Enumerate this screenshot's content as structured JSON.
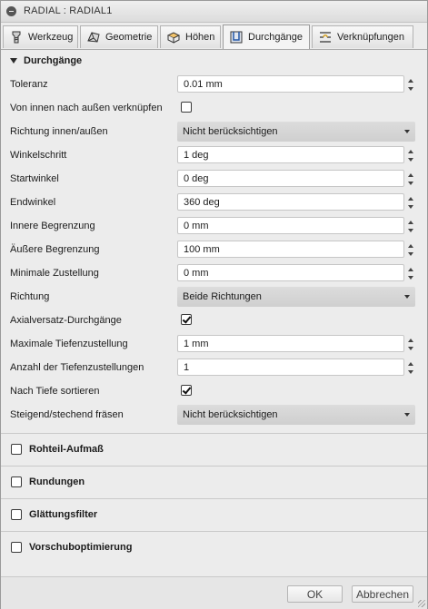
{
  "window": {
    "title": "RADIAL : RADIAL1"
  },
  "tabs": [
    {
      "label": "Werkzeug",
      "icon": "tool-icon"
    },
    {
      "label": "Geometrie",
      "icon": "geometry-icon"
    },
    {
      "label": "Höhen",
      "icon": "heights-icon"
    },
    {
      "label": "Durchgänge",
      "icon": "passes-icon",
      "active": true
    },
    {
      "label": "Verknüpfungen",
      "icon": "linking-icon"
    }
  ],
  "section": {
    "title": "Durchgänge"
  },
  "rows": [
    {
      "label": "Toleranz",
      "type": "number",
      "value": "0.01 mm"
    },
    {
      "label": "Von innen nach außen verknüpfen",
      "type": "checkbox",
      "checked": false
    },
    {
      "label": "Richtung innen/außen",
      "type": "select",
      "value": "Nicht berücksichtigen"
    },
    {
      "label": "Winkelschritt",
      "type": "number",
      "value": "1 deg"
    },
    {
      "label": "Startwinkel",
      "type": "number",
      "value": "0 deg"
    },
    {
      "label": "Endwinkel",
      "type": "number",
      "value": "360 deg"
    },
    {
      "label": "Innere Begrenzung",
      "type": "number",
      "value": "0 mm"
    },
    {
      "label": "Äußere Begrenzung",
      "type": "number",
      "value": "100 mm"
    },
    {
      "label": "Minimale Zustellung",
      "type": "number",
      "value": "0 mm"
    },
    {
      "label": "Richtung",
      "type": "select",
      "value": "Beide Richtungen"
    },
    {
      "label": "Axialversatz-Durchgänge",
      "type": "checkbox",
      "checked": true
    },
    {
      "label": "Maximale Tiefenzustellung",
      "type": "number",
      "value": "1 mm"
    },
    {
      "label": "Anzahl der Tiefenzustellungen",
      "type": "number",
      "value": "1"
    },
    {
      "label": "Nach Tiefe sortieren",
      "type": "checkbox",
      "checked": true
    },
    {
      "label": "Steigend/stechend fräsen",
      "type": "select",
      "value": "Nicht berücksichtigen"
    }
  ],
  "groups": [
    {
      "label": "Rohteil-Aufmaß",
      "checked": false
    },
    {
      "label": "Rundungen",
      "checked": false
    },
    {
      "label": "Glättungsfilter",
      "checked": false
    },
    {
      "label": "Vorschuboptimierung",
      "checked": false
    }
  ],
  "footer": {
    "ok": "OK",
    "cancel": "Abbrechen"
  }
}
